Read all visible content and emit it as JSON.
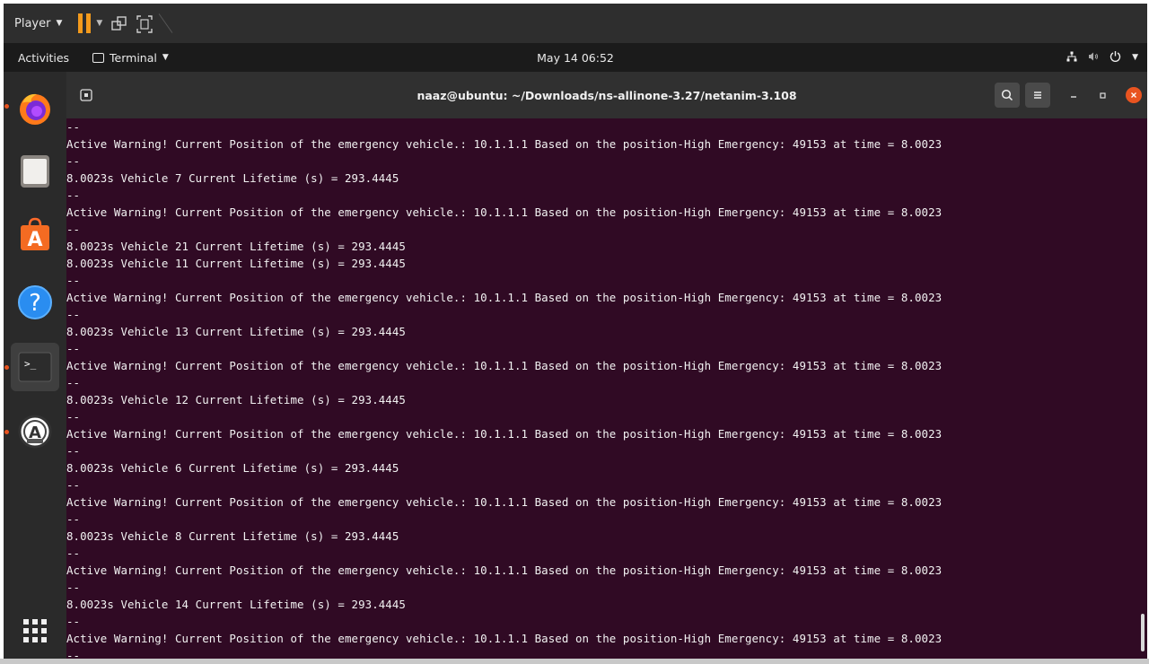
{
  "player": {
    "menu_label": "Player",
    "accent": "#f39a1c"
  },
  "topbar": {
    "activities": "Activities",
    "app_menu": "Terminal",
    "clock": "May 14 06:52"
  },
  "dock": {
    "items": [
      "firefox-icon",
      "files-icon",
      "software-store-icon",
      "help-icon",
      "terminal-icon",
      "software-updater-icon"
    ],
    "show_apps": "show-applications-icon",
    "running_dot_color": "#e95420"
  },
  "terminal": {
    "title": "naaz@ubuntu: ~/Downloads/ns-allinone-3.27/netanim-3.108",
    "background": "#300a24",
    "lines": [
      "--",
      "Active Warning! Current Position of the emergency vehicle.: 10.1.1.1 Based on the position-High Emergency: 49153 at time = 8.0023",
      "--",
      "8.0023s Vehicle 7 Current Lifetime (s) = 293.4445",
      "--",
      "Active Warning! Current Position of the emergency vehicle.: 10.1.1.1 Based on the position-High Emergency: 49153 at time = 8.0023",
      "--",
      "8.0023s Vehicle 21 Current Lifetime (s) = 293.4445",
      "8.0023s Vehicle 11 Current Lifetime (s) = 293.4445",
      "--",
      "Active Warning! Current Position of the emergency vehicle.: 10.1.1.1 Based on the position-High Emergency: 49153 at time = 8.0023",
      "--",
      "8.0023s Vehicle 13 Current Lifetime (s) = 293.4445",
      "--",
      "Active Warning! Current Position of the emergency vehicle.: 10.1.1.1 Based on the position-High Emergency: 49153 at time = 8.0023",
      "--",
      "8.0023s Vehicle 12 Current Lifetime (s) = 293.4445",
      "--",
      "Active Warning! Current Position of the emergency vehicle.: 10.1.1.1 Based on the position-High Emergency: 49153 at time = 8.0023",
      "--",
      "8.0023s Vehicle 6 Current Lifetime (s) = 293.4445",
      "--",
      "Active Warning! Current Position of the emergency vehicle.: 10.1.1.1 Based on the position-High Emergency: 49153 at time = 8.0023",
      "--",
      "8.0023s Vehicle 8 Current Lifetime (s) = 293.4445",
      "--",
      "Active Warning! Current Position of the emergency vehicle.: 10.1.1.1 Based on the position-High Emergency: 49153 at time = 8.0023",
      "--",
      "8.0023s Vehicle 14 Current Lifetime (s) = 293.4445",
      "--",
      "Active Warning! Current Position of the emergency vehicle.: 10.1.1.1 Based on the position-High Emergency: 49153 at time = 8.0023",
      "--"
    ]
  }
}
